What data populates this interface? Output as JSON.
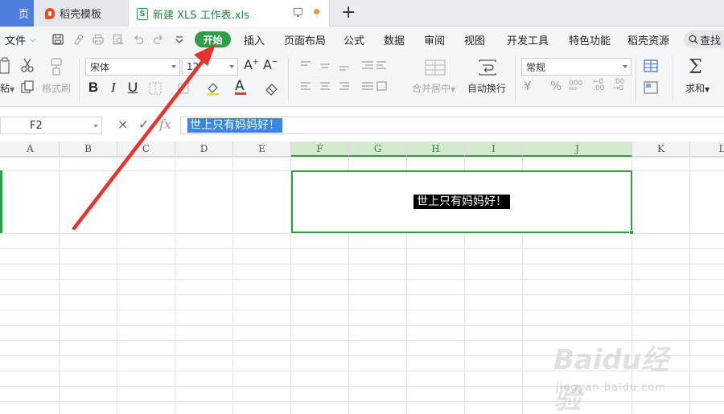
{
  "tabs": {
    "home": "页",
    "template": "稻壳模板",
    "document": "新建 XLS 工作表.xls",
    "new_tab": "+"
  },
  "menu": {
    "file": "文件",
    "items": [
      "开始",
      "插入",
      "页面布局",
      "公式",
      "数据",
      "审阅",
      "视图",
      "开发工具",
      "特色功能",
      "稻壳资源"
    ],
    "search": "查找"
  },
  "ribbon": {
    "paste": "粘",
    "format_painter": "格式刷",
    "font_name": "宋体",
    "font_size": "12",
    "bold": "B",
    "italic": "I",
    "underline": "U",
    "merge_center": "合并居中",
    "wrap_text": "自动换行",
    "number_format": "常规",
    "sum": "求和"
  },
  "formula_bar": {
    "cell_ref": "F2",
    "cancel": "×",
    "confirm": "✓",
    "fx": "fx",
    "value": "世上只有妈妈好！"
  },
  "grid": {
    "columns": [
      "A",
      "B",
      "C",
      "D",
      "E",
      "F",
      "G",
      "H",
      "I",
      "J",
      "K",
      "L"
    ],
    "selected_columns": [
      "F",
      "G",
      "H",
      "I",
      "J"
    ],
    "merged_cell_value": "世上只有妈妈好！"
  },
  "watermark": {
    "brand": "Baidu经验",
    "url": "jingyan.baidu.com"
  },
  "colors": {
    "accent_green": "#2e9e4a",
    "selection_blue": "#3a86e6",
    "annotation_red": "#e8332a"
  }
}
